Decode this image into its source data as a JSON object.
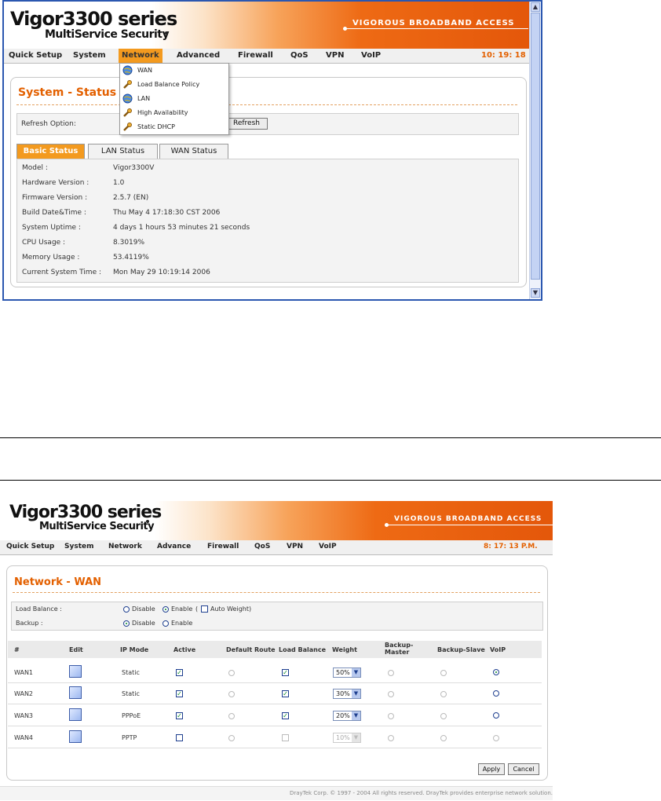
{
  "shot1": {
    "logo": {
      "main": "Vigor3300 series",
      "sub": "MultiService Security"
    },
    "tagline": "VIGOROUS BROADBAND ACCESS",
    "menu": [
      {
        "label": "Quick Setup"
      },
      {
        "label": "System"
      },
      {
        "label": "Network",
        "active": true
      },
      {
        "label": "Advanced"
      },
      {
        "label": "Firewall"
      },
      {
        "label": "QoS"
      },
      {
        "label": "VPN"
      },
      {
        "label": "VoIP"
      }
    ],
    "clock": "10: 19: 18",
    "dropdown": [
      {
        "label": "WAN",
        "icon": "globe-icon"
      },
      {
        "label": "Load Balance Policy",
        "icon": "wrench-icon"
      },
      {
        "label": "LAN",
        "icon": "globe-icon"
      },
      {
        "label": "High Availability",
        "icon": "wrench-icon"
      },
      {
        "label": "Static DHCP",
        "icon": "wrench-icon"
      }
    ],
    "panel_title": "System - Status",
    "refresh_label": "Refresh Option:",
    "refresh_button": "Refresh",
    "tabs": [
      {
        "label": "Basic Status",
        "active": true
      },
      {
        "label": "LAN Status"
      },
      {
        "label": "WAN Status"
      }
    ],
    "status_rows": [
      {
        "label": "Model :",
        "value": "Vigor3300V"
      },
      {
        "label": "Hardware Version :",
        "value": "1.0"
      },
      {
        "label": "Firmware Version :",
        "value": "2.5.7 (EN)"
      },
      {
        "label": "Build Date&Time :",
        "value": "Thu May 4 17:18:30 CST 2006"
      },
      {
        "label": "System Uptime :",
        "value": "4 days 1 hours 53 minutes 21 seconds"
      },
      {
        "label": "CPU Usage :",
        "value": "8.3019%"
      },
      {
        "label": "Memory Usage :",
        "value": "53.4119%"
      },
      {
        "label": "Current System Time :",
        "value": "Mon May 29 10:19:14 2006"
      }
    ]
  },
  "shot2": {
    "logo": {
      "main": "Vigor3300 series",
      "sub": "MultiService Security"
    },
    "tagline": "VIGOROUS BROADBAND ACCESS",
    "menu": [
      "Quick Setup",
      "System",
      "Network",
      "Advance",
      "Firewall",
      "QoS",
      "VPN",
      "VoIP"
    ],
    "clock": "8: 17: 13 P.M.",
    "panel_title": "Network - WAN",
    "load_balance": {
      "label": "Load Balance :",
      "opt_disable": "Disable",
      "opt_enable": "Enable",
      "paren_open": "(",
      "auto_weight": "Auto Weight)",
      "selected": "Enable"
    },
    "backup": {
      "label": "Backup :",
      "opt_disable": "Disable",
      "opt_enable": "Enable",
      "selected": "Disable"
    },
    "columns": {
      "num": "#",
      "edit": "Edit",
      "ip_mode": "IP Mode",
      "active": "Active",
      "default_route": "Default Route",
      "load_balance": "Load Balance",
      "weight": "Weight",
      "backup_master": "Backup-\nMaster",
      "backup_slave": "Backup-Slave",
      "voip": "VoIP"
    },
    "rows": [
      {
        "name": "WAN1",
        "ip_mode": "Static",
        "active": true,
        "load_balance": true,
        "weight": "50%",
        "voip": true,
        "enabled": true
      },
      {
        "name": "WAN2",
        "ip_mode": "Static",
        "active": true,
        "load_balance": true,
        "weight": "30%",
        "voip": false,
        "enabled": true
      },
      {
        "name": "WAN3",
        "ip_mode": "PPPoE",
        "active": true,
        "load_balance": true,
        "weight": "20%",
        "voip": false,
        "enabled": true
      },
      {
        "name": "WAN4",
        "ip_mode": "PPTP",
        "active": false,
        "load_balance": false,
        "weight": "10%",
        "voip": false,
        "enabled": false
      }
    ],
    "apply_button": "Apply",
    "cancel_button": "Cancel",
    "footer": "DrayTek Corp. © 1997 - 2004 All rights reserved. DrayTek provides enterprise network solution."
  },
  "colors": {
    "accent": "#e36000",
    "menu_active": "#f39a1f",
    "frame_border": "#2b57b0"
  }
}
